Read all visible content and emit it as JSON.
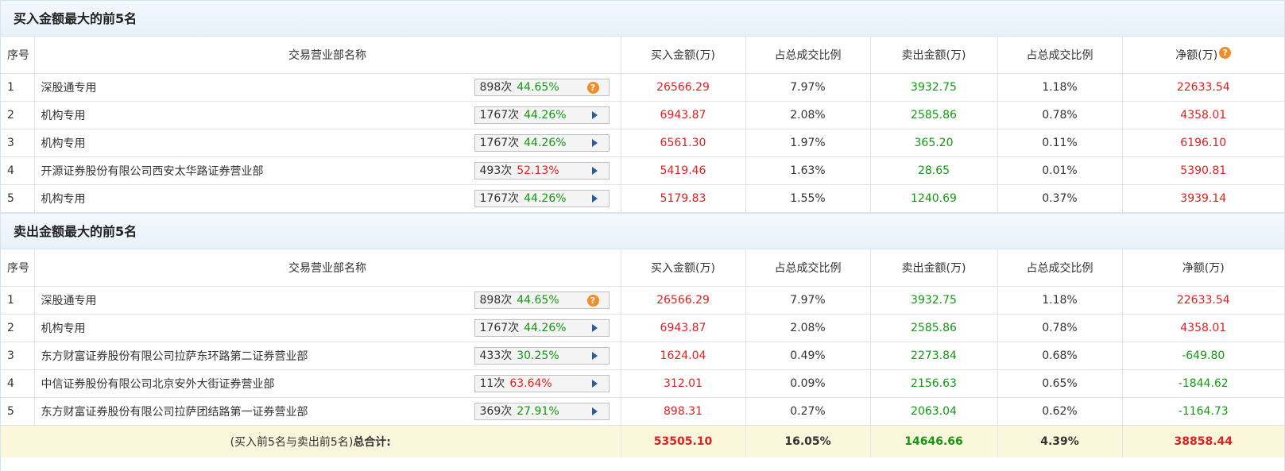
{
  "headers": [
    "序号",
    "交易营业部名称",
    "买入金额(万)",
    "占总成交比例",
    "卖出金额(万)",
    "占总成交比例",
    "净额(万)"
  ],
  "buy_section": {
    "title": "买入金额最大的前5名",
    "rows": [
      {
        "seq": "1",
        "name": "深股通专用",
        "count": "898次",
        "pct": "44.65%",
        "pct_color": "green",
        "marker": "question",
        "buy": "26566.29",
        "buy_ratio": "7.97%",
        "sell": "3932.75",
        "sell_ratio": "1.18%",
        "net": "22633.54",
        "net_color": "red"
      },
      {
        "seq": "2",
        "name": "机构专用",
        "count": "1767次",
        "pct": "44.26%",
        "pct_color": "green",
        "marker": "arrow",
        "buy": "6943.87",
        "buy_ratio": "2.08%",
        "sell": "2585.86",
        "sell_ratio": "0.78%",
        "net": "4358.01",
        "net_color": "red"
      },
      {
        "seq": "3",
        "name": "机构专用",
        "count": "1767次",
        "pct": "44.26%",
        "pct_color": "green",
        "marker": "arrow",
        "buy": "6561.30",
        "buy_ratio": "1.97%",
        "sell": "365.20",
        "sell_ratio": "0.11%",
        "net": "6196.10",
        "net_color": "red"
      },
      {
        "seq": "4",
        "name": "开源证券股份有限公司西安太华路证券营业部",
        "count": "493次",
        "pct": "52.13%",
        "pct_color": "red",
        "marker": "arrow",
        "buy": "5419.46",
        "buy_ratio": "1.63%",
        "sell": "28.65",
        "sell_ratio": "0.01%",
        "net": "5390.81",
        "net_color": "red"
      },
      {
        "seq": "5",
        "name": "机构专用",
        "count": "1767次",
        "pct": "44.26%",
        "pct_color": "green",
        "marker": "arrow",
        "buy": "5179.83",
        "buy_ratio": "1.55%",
        "sell": "1240.69",
        "sell_ratio": "0.37%",
        "net": "3939.14",
        "net_color": "red"
      }
    ]
  },
  "sell_section": {
    "title": "卖出金额最大的前5名",
    "rows": [
      {
        "seq": "1",
        "name": "深股通专用",
        "count": "898次",
        "pct": "44.65%",
        "pct_color": "green",
        "marker": "question",
        "buy": "26566.29",
        "buy_ratio": "7.97%",
        "sell": "3932.75",
        "sell_ratio": "1.18%",
        "net": "22633.54",
        "net_color": "red"
      },
      {
        "seq": "2",
        "name": "机构专用",
        "count": "1767次",
        "pct": "44.26%",
        "pct_color": "green",
        "marker": "arrow",
        "buy": "6943.87",
        "buy_ratio": "2.08%",
        "sell": "2585.86",
        "sell_ratio": "0.78%",
        "net": "4358.01",
        "net_color": "red"
      },
      {
        "seq": "3",
        "name": "东方财富证券股份有限公司拉萨东环路第二证券营业部",
        "count": "433次",
        "pct": "30.25%",
        "pct_color": "green",
        "marker": "arrow",
        "buy": "1624.04",
        "buy_ratio": "0.49%",
        "sell": "2273.84",
        "sell_ratio": "0.68%",
        "net": "-649.80",
        "net_color": "green"
      },
      {
        "seq": "4",
        "name": "中信证券股份有限公司北京安外大街证券营业部",
        "count": "11次",
        "pct": "63.64%",
        "pct_color": "red",
        "marker": "arrow",
        "buy": "312.01",
        "buy_ratio": "0.09%",
        "sell": "2156.63",
        "sell_ratio": "0.65%",
        "net": "-1844.62",
        "net_color": "green"
      },
      {
        "seq": "5",
        "name": "东方财富证券股份有限公司拉萨团结路第一证券营业部",
        "count": "369次",
        "pct": "27.91%",
        "pct_color": "green",
        "marker": "arrow",
        "buy": "898.31",
        "buy_ratio": "0.27%",
        "sell": "2063.04",
        "sell_ratio": "0.62%",
        "net": "-1164.73",
        "net_color": "green"
      }
    ]
  },
  "total": {
    "label_prefix": "(买入前5名与卖出前5名)",
    "label_bold": "总合计:",
    "buy": "53505.10",
    "buy_ratio": "16.05%",
    "sell": "14646.66",
    "sell_ratio": "4.39%",
    "net": "38858.44"
  },
  "icons": {
    "question": "?"
  },
  "colors": {
    "red": "#e02020",
    "green": "#119911",
    "header_bg": "#e8f1fa",
    "total_bg": "#fbf7dc",
    "question_icon": "#f08c2a",
    "arrow_icon": "#2a5c9c"
  }
}
